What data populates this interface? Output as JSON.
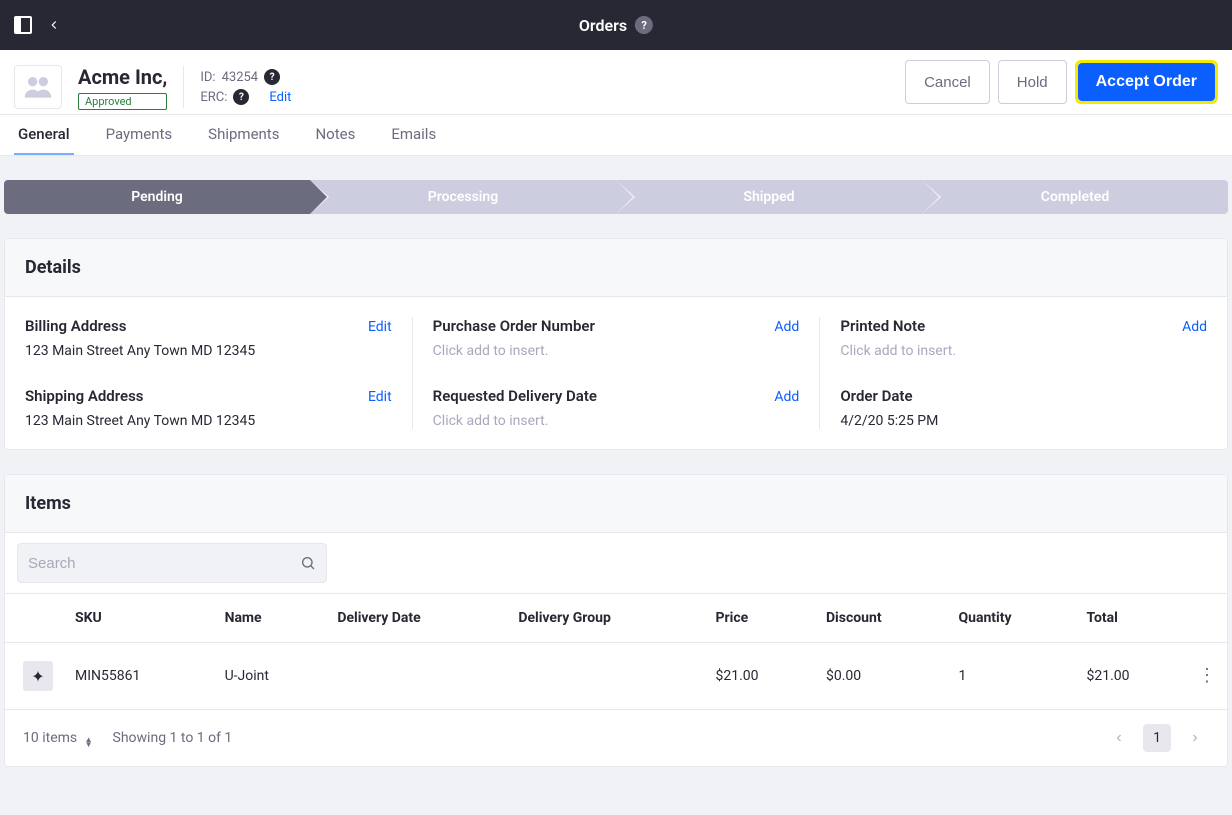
{
  "topbar": {
    "title": "Orders"
  },
  "header": {
    "company": "Acme Inc,",
    "status_badge": "Approved",
    "id_label": "ID:",
    "id_value": "43254",
    "erc_label": "ERC:",
    "edit_link": "Edit",
    "actions": {
      "cancel": "Cancel",
      "hold": "Hold",
      "accept": "Accept Order"
    }
  },
  "tabs": [
    "General",
    "Payments",
    "Shipments",
    "Notes",
    "Emails"
  ],
  "active_tab": 0,
  "steps": [
    "Pending",
    "Processing",
    "Shipped",
    "Completed"
  ],
  "active_step": 0,
  "details": {
    "title": "Details",
    "billing": {
      "label": "Billing Address",
      "action": "Edit",
      "value": "123 Main Street Any Town MD 12345"
    },
    "shipping": {
      "label": "Shipping Address",
      "action": "Edit",
      "value": "123 Main Street Any Town MD 12345"
    },
    "po": {
      "label": "Purchase Order Number",
      "action": "Add",
      "placeholder": "Click add to insert."
    },
    "requested_delivery": {
      "label": "Requested Delivery Date",
      "action": "Add",
      "placeholder": "Click add to insert."
    },
    "printed_note": {
      "label": "Printed Note",
      "action": "Add",
      "placeholder": "Click add to insert."
    },
    "order_date": {
      "label": "Order Date",
      "value": "4/2/20 5:25 PM"
    }
  },
  "items": {
    "title": "Items",
    "search_placeholder": "Search",
    "columns": [
      "SKU",
      "Name",
      "Delivery Date",
      "Delivery Group",
      "Price",
      "Discount",
      "Quantity",
      "Total"
    ],
    "rows": [
      {
        "sku": "MIN55861",
        "name": "U-Joint",
        "delivery_date": "",
        "delivery_group": "",
        "price": "$21.00",
        "discount": "$0.00",
        "quantity": "1",
        "total": "$21.00"
      }
    ],
    "footer": {
      "page_size": "10 items",
      "showing": "Showing 1 to 1 of 1",
      "page": "1"
    }
  }
}
